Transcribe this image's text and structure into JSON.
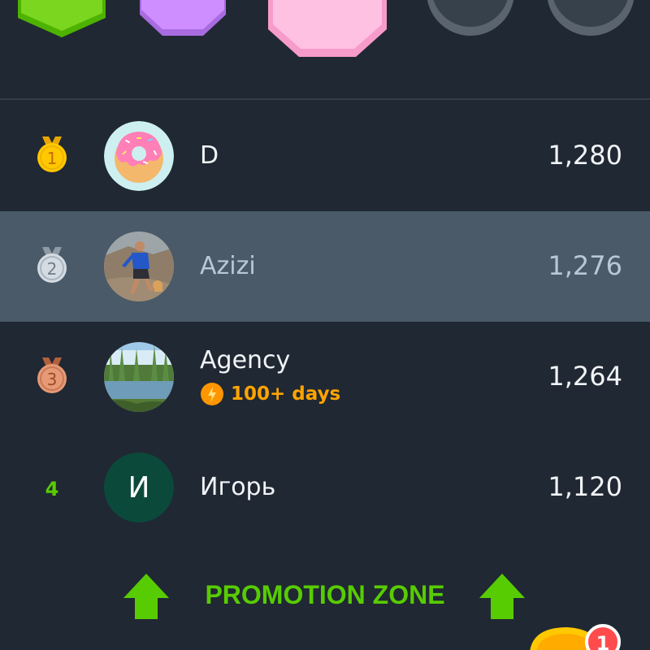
{
  "colors": {
    "background": "#202833",
    "current_row": "#4a5a68",
    "promotion_green": "#58cc02",
    "streak_orange": "#ffa400",
    "gold": "#ffc800",
    "silver": "#c8d0d8",
    "bronze": "#e0916a"
  },
  "league_badges": [
    {
      "name": "green-league-badge",
      "color": "#58cc02"
    },
    {
      "name": "purple-league-badge",
      "color": "#ce82ff"
    },
    {
      "name": "pink-league-badge",
      "color": "#ffb0d8",
      "state": "current"
    },
    {
      "name": "locked-league-badge",
      "color": "#6f7b86",
      "state": "locked"
    },
    {
      "name": "locked-league-badge",
      "color": "#6f7b86",
      "state": "locked"
    }
  ],
  "leaderboard": [
    {
      "rank": "1",
      "medal": "gold-medal-icon",
      "avatar": "donut-avatar",
      "name": "D",
      "xp": "1,280"
    },
    {
      "rank": "2",
      "medal": "silver-medal-icon",
      "avatar": "runner-photo-avatar",
      "name": "Azizi",
      "xp": "1,276",
      "current_user": true
    },
    {
      "rank": "3",
      "medal": "bronze-medal-icon",
      "avatar": "lake-photo-avatar",
      "name": "Agency",
      "streak": "100+ days",
      "xp": "1,264"
    },
    {
      "rank": "4",
      "avatar_letter": "И",
      "name": "Игорь",
      "xp": "1,120"
    }
  ],
  "promotion": {
    "label": "PROMOTION ZONE",
    "icon": "up-arrow-icon"
  },
  "notification": {
    "icon": "treasure-chest-icon",
    "badge_count": "1"
  }
}
